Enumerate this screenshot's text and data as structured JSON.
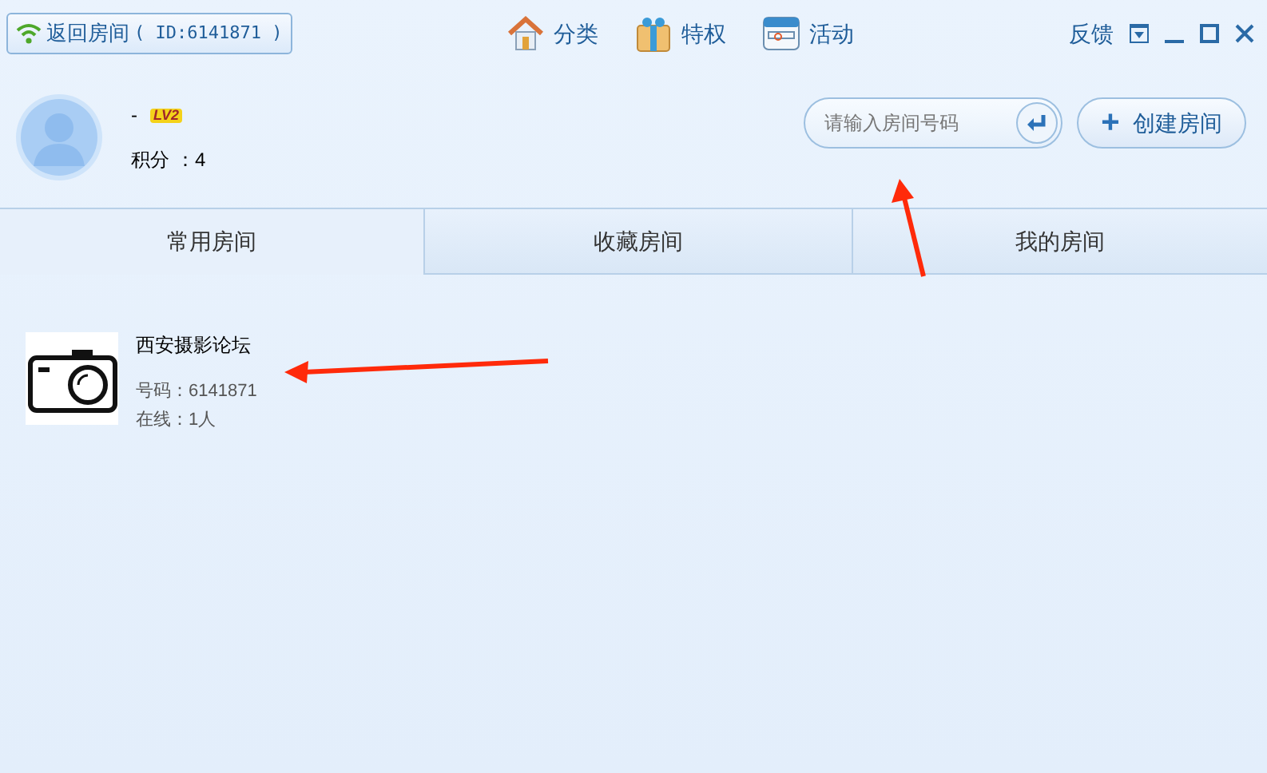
{
  "back_button": {
    "label": "返回房间",
    "id_text": "( ID:6141871 )"
  },
  "nav": [
    {
      "kind": "home",
      "label": "分类"
    },
    {
      "kind": "gift",
      "label": "特权"
    },
    {
      "kind": "calendar",
      "label": "活动"
    }
  ],
  "feedback": "反馈",
  "profile": {
    "name": "-",
    "level_badge": "LV2",
    "points_label": "积分",
    "points_value": "：4"
  },
  "search": {
    "placeholder": "请输入房间号码"
  },
  "create_button": {
    "icon": "+",
    "label": "创建房间"
  },
  "tabs": [
    {
      "label": "常用房间",
      "selected": true
    },
    {
      "label": "收藏房间",
      "selected": false
    },
    {
      "label": "我的房间",
      "selected": false
    }
  ],
  "rooms": [
    {
      "title": "西安摄影论坛",
      "number": "号码：6141871",
      "online": "在线：1人"
    }
  ]
}
